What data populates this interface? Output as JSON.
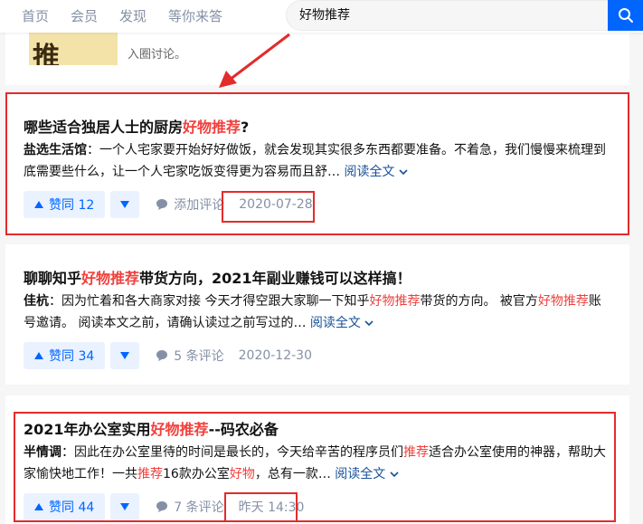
{
  "nav": [
    "首页",
    "会员",
    "发现",
    "等你来答"
  ],
  "search": {
    "value": "好物推荐"
  },
  "top_card": {
    "thumb_text": "推荐",
    "snippet": "入圈讨论。"
  },
  "results": [
    {
      "title_parts": [
        "哪些适合独居人士的厨房",
        "好物推荐",
        "?"
      ],
      "author": "盐选生活馆",
      "excerpt_parts": [
        "：一个人宅家要开始好好做饭，就会发现其实很多东西都要准备。不着急，我们慢慢来梳理到底需要些什么，让一个人宅家吃饭变得更为容易而且舒… "
      ],
      "read_more": "阅读全文",
      "votes": "赞同 12",
      "comments": "添加评论",
      "date": "2020-07-28"
    },
    {
      "title_parts": [
        "聊聊知乎",
        "好物推荐",
        "带货方向，2021年副业赚钱可以这样搞！"
      ],
      "author": "佳杭",
      "excerpt_parts": [
        "：因为忙着和各大商家对接 今天才得空跟大家聊一下知乎",
        "好物推荐",
        "带货的方向。 被官方",
        "好物推荐",
        "账号邀请。 阅读本文之前，请确认读过之前写过的… "
      ],
      "read_more": "阅读全文",
      "votes": "赞同 34",
      "comments": "5 条评论",
      "date": "2020-12-30"
    },
    {
      "title_parts": [
        "2021年办公室实用",
        "好物推荐",
        "--码农必备"
      ],
      "author": "半情调",
      "excerpt_parts": [
        "：因此在办公室里待的时间是最长的，今天给辛苦的程序员们",
        "推荐",
        "适合办公室使用的神器，帮助大家愉快地工作！一共",
        "推荐",
        "16款办公室",
        "好物",
        "，总有一款… "
      ],
      "read_more": "阅读全文",
      "votes": "赞同 44",
      "comments": "7 条评论",
      "date": "昨天 14:30"
    }
  ],
  "colors": {
    "accent": "#0066ff",
    "highlight": "#f1403c",
    "annotation": "#e32b2b"
  }
}
